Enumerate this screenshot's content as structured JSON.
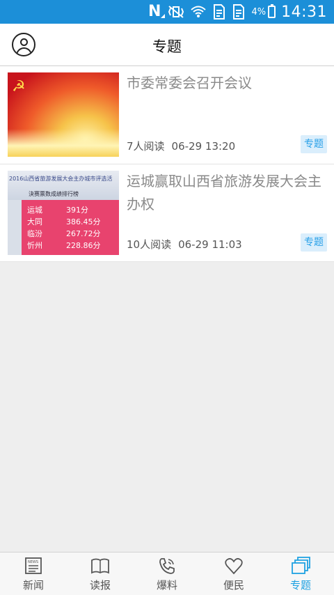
{
  "status_bar": {
    "battery_text": "4%",
    "time": "14:31"
  },
  "header": {
    "title": "专题"
  },
  "articles": [
    {
      "title": "市委常委会召开会议",
      "reads": "7人阅读",
      "date": "06-29 13:20",
      "tag": "专题",
      "thumbnail": "red-flag-background"
    },
    {
      "title": "运城赢取山西省旅游发展大会主办权",
      "reads": "10人阅读",
      "date": "06-29 11:03",
      "tag": "专题",
      "thumbnail": "ranking-board-photo",
      "photo_text": {
        "banner_line1": "2016山西省旅游发展大会主办城市评选活",
        "banner_line2": "決赛票数成绩排行榜",
        "rows": [
          {
            "city": "运城",
            "score": "391分"
          },
          {
            "city": "大同",
            "score": "386.45分"
          },
          {
            "city": "临汾",
            "score": "267.72分"
          },
          {
            "city": "忻州",
            "score": "228.86分"
          }
        ]
      }
    }
  ],
  "bottom_nav": {
    "items": [
      {
        "label": "新闻",
        "icon": "newspaper-icon"
      },
      {
        "label": "读报",
        "icon": "open-paper-icon"
      },
      {
        "label": "爆料",
        "icon": "phone-icon"
      },
      {
        "label": "便民",
        "icon": "heart-icon"
      },
      {
        "label": "专题",
        "icon": "stacked-cards-icon"
      }
    ],
    "active_index": 4,
    "active_color": "#1ea1e2"
  },
  "colors": {
    "status_bar": "#1c8fd8",
    "tag_bg": "#daeefc",
    "tag_text": "#28a0e8"
  }
}
